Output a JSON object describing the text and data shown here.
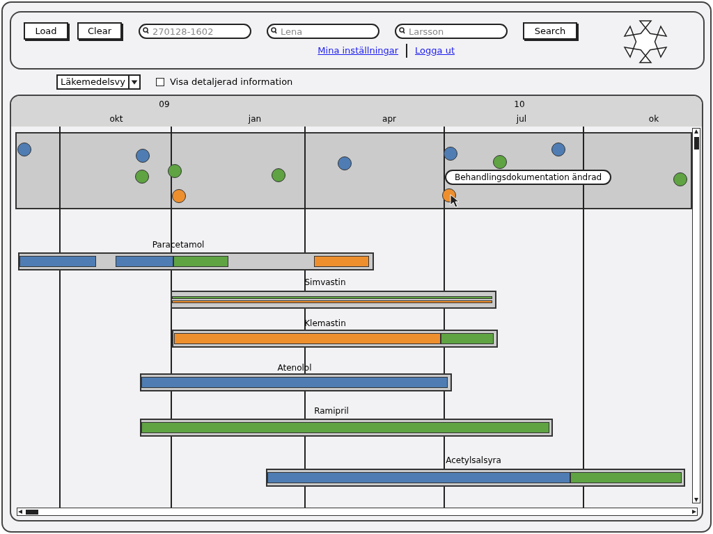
{
  "header": {
    "buttons": [
      "Load",
      "Clear"
    ],
    "search_fields": [
      {
        "placeholder": "270128-1602"
      },
      {
        "placeholder": "Lena"
      },
      {
        "placeholder": "Larsson"
      }
    ],
    "search_button": "Search",
    "links": [
      "Mina inställningar",
      "Logga ut"
    ]
  },
  "toolbar": {
    "view_select": "Läkemedelsvy",
    "detail_checkbox": {
      "label": "Visa detaljerad information",
      "checked": false
    }
  },
  "timeline": {
    "years": [
      "09",
      "10"
    ],
    "months": [
      "okt",
      "jan",
      "apr",
      "jul",
      "ok"
    ],
    "events": [
      {
        "color": "#4f7db3"
      },
      {
        "color": "#4f7db3"
      },
      {
        "color": "#4f7db3"
      },
      {
        "color": "#4f7db3"
      },
      {
        "color": "#4f7db3"
      },
      {
        "color": "#5fa343"
      },
      {
        "color": "#5fa343"
      },
      {
        "color": "#5fa343"
      },
      {
        "color": "#5fa343"
      },
      {
        "color": "#5fa343"
      },
      {
        "color": "#ee8f2e"
      },
      {
        "color": "#ee8f2e"
      }
    ],
    "tooltip": "Behandlingsdokumentation ändrad",
    "medications": [
      {
        "name": "Paracetamol",
        "segments": [
          {
            "color": "#4f7db3"
          },
          {
            "color": "#4f7db3"
          },
          {
            "color": "#5fa343"
          },
          {
            "color": "#ee8f2e"
          }
        ]
      },
      {
        "name": "Simvastin",
        "segments": [
          {
            "color": "#5fa343"
          },
          {
            "color": "#ee8f2e"
          }
        ]
      },
      {
        "name": "Klemastin",
        "segments": [
          {
            "color": "#ee8f2e"
          },
          {
            "color": "#5fa343"
          }
        ]
      },
      {
        "name": "Atenolol",
        "segments": [
          {
            "color": "#4f7db3"
          }
        ]
      },
      {
        "name": "Ramipril",
        "segments": [
          {
            "color": "#5fa343"
          }
        ]
      },
      {
        "name": "Acetylsalsyra",
        "segments": [
          {
            "color": "#4f7db3"
          },
          {
            "color": "#5fa343"
          }
        ]
      }
    ]
  }
}
